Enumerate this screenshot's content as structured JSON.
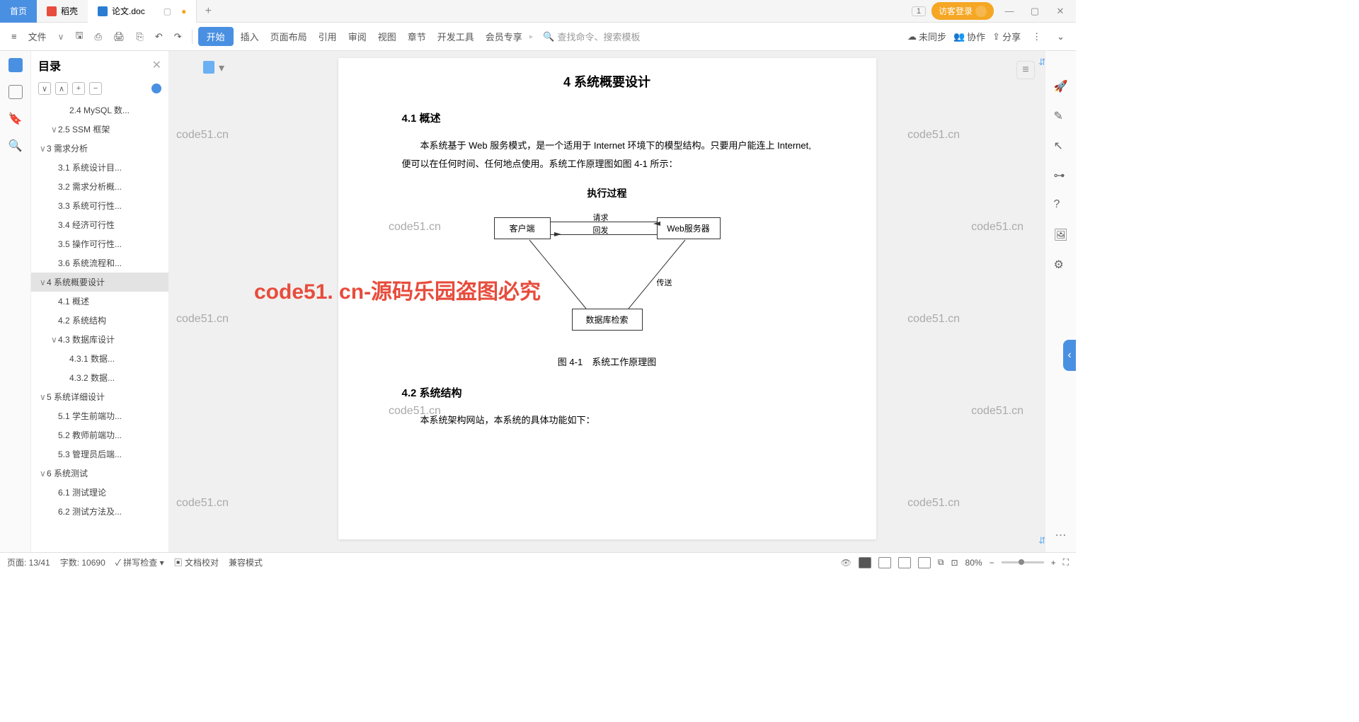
{
  "titlebar": {
    "home": "首页",
    "docao": "稻壳",
    "doc_icon": "W",
    "doc_name": "论文.doc",
    "newtab": "+",
    "page_count_box": "1",
    "guest_login": "访客登录"
  },
  "toolbar": {
    "menu": "≡",
    "file": "文件",
    "start": "开始",
    "insert": "插入",
    "pagelayout": "页面布局",
    "reference": "引用",
    "review": "审阅",
    "view": "视图",
    "chapter": "章节",
    "devtools": "开发工具",
    "member": "会员专享",
    "search_placeholder": "查找命令、搜索模板",
    "unsynced": "未同步",
    "collab": "协作",
    "share": "分享"
  },
  "outline": {
    "title": "目录",
    "items": [
      {
        "lvl": "l2",
        "text": "2.4 MySQL 数..."
      },
      {
        "lvl": "l1",
        "text": "2.5 SSM 框架",
        "caret": "∨"
      },
      {
        "lvl": "l0",
        "text": "3  需求分析",
        "caret": "∨"
      },
      {
        "lvl": "l1",
        "text": "3.1  系统设计目..."
      },
      {
        "lvl": "l1",
        "text": "3.2 需求分析概..."
      },
      {
        "lvl": "l1",
        "text": "3.3  系统可行性..."
      },
      {
        "lvl": "l1",
        "text": "3.4 经济可行性"
      },
      {
        "lvl": "l1",
        "text": "3.5 操作可行性..."
      },
      {
        "lvl": "l1",
        "text": "3.6 系统流程和..."
      },
      {
        "lvl": "l0",
        "text": "4 系统概要设计",
        "caret": "∨",
        "active": true
      },
      {
        "lvl": "l1",
        "text": "4.1  概述"
      },
      {
        "lvl": "l1",
        "text": "4.2  系统结构"
      },
      {
        "lvl": "l1",
        "text": "4.3  数据库设计",
        "caret": "∨"
      },
      {
        "lvl": "l2",
        "text": "4.3.1  数据..."
      },
      {
        "lvl": "l2",
        "text": "4.3.2  数据..."
      },
      {
        "lvl": "l0",
        "text": "5 系统详细设计",
        "caret": "∨"
      },
      {
        "lvl": "l1",
        "text": "5.1 学生前端功..."
      },
      {
        "lvl": "l1",
        "text": "5.2 教师前端功..."
      },
      {
        "lvl": "l1",
        "text": "5.3 管理员后端..."
      },
      {
        "lvl": "l0",
        "text": "6  系统测试",
        "caret": "∨"
      },
      {
        "lvl": "l1",
        "text": "6.1  测试理论"
      },
      {
        "lvl": "l1",
        "text": "6.2  测试方法及..."
      }
    ]
  },
  "doc": {
    "h1": "4 系统概要设计",
    "s41_title": "4.1  概述",
    "s41_p1": "本系统基于 Web 服务模式，是一个适用于 Internet 环境下的模型结构。只要用户能连上 Internet, 便可以在任何时间、任何地点使用。系统工作原理图如图 4-1 所示：",
    "exec": "执行过程",
    "diagram": {
      "client": "客户端",
      "request": "请求",
      "reply": "回发",
      "server": "Web服务器",
      "send": "传送",
      "db": "数据库检索"
    },
    "fig_cap": "图 4-1　系统工作原理图",
    "s42_title": "4.2  系统结构",
    "s42_p1": "本系统架构网站，本系统的具体功能如下：",
    "watermark_small": "code51.cn",
    "watermark_big": "code51. cn-源码乐园盗图必究"
  },
  "status": {
    "page": "页面: 13/41",
    "words": "字数: 10690",
    "spellcheck": "拼写检查",
    "proofread": "文档校对",
    "compat": "兼容模式",
    "zoom": "80%"
  }
}
